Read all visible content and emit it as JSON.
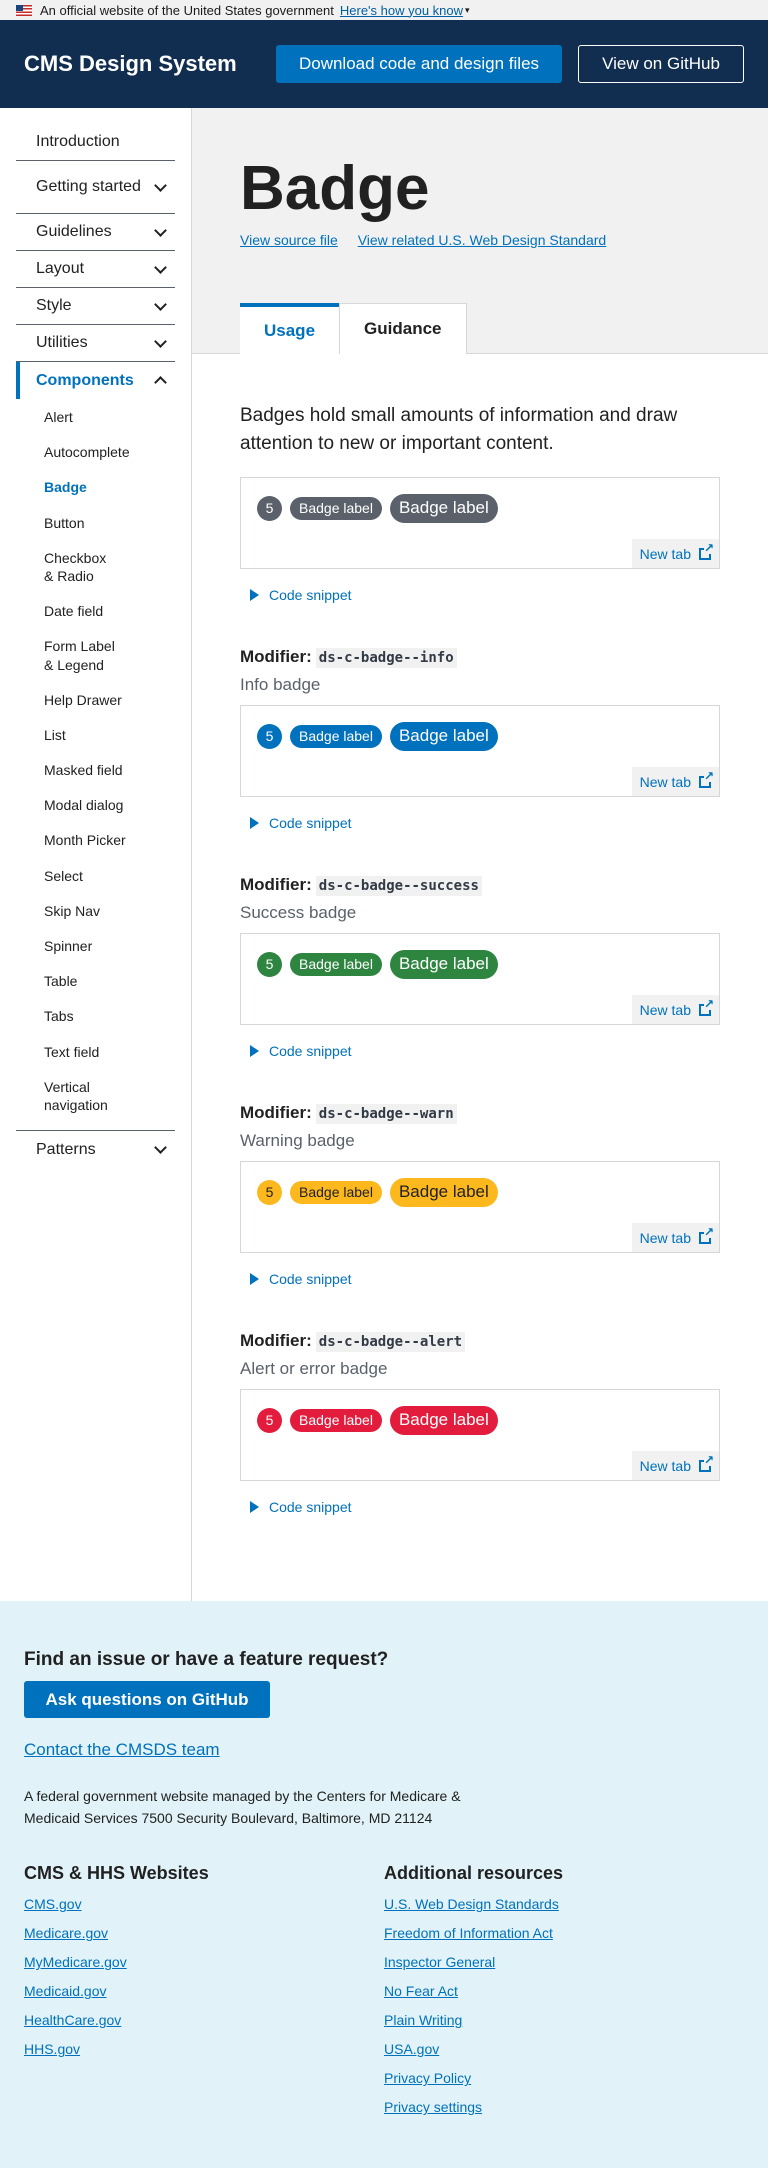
{
  "gov_banner": {
    "text": "An official website of the United States government",
    "link": "Here's how you know"
  },
  "header": {
    "logo": "CMS Design System",
    "download_label": "Download code and design files",
    "github_label": "View on GitHub"
  },
  "sidebar": {
    "top_items": [
      {
        "label": "Introduction"
      },
      {
        "label": "Getting started"
      },
      {
        "label": "Guidelines"
      },
      {
        "label": "Layout"
      },
      {
        "label": "Style"
      },
      {
        "label": "Utilities"
      }
    ],
    "components_label": "Components",
    "components": [
      "Alert",
      "Autocomplete",
      "Badge",
      "Button",
      "Checkbox & Radio",
      "Date field",
      "Form Label & Legend",
      "Help Drawer",
      "List",
      "Masked field",
      "Modal dialog",
      "Month Picker",
      "Select",
      "Skip Nav",
      "Spinner",
      "Table",
      "Tabs",
      "Text field",
      "Vertical navigation"
    ],
    "patterns_label": "Patterns"
  },
  "page": {
    "title": "Badge",
    "view_source": "View source file",
    "view_related": "View related U.S. Web Design Standard",
    "tab_usage": "Usage",
    "tab_guidance": "Guidance",
    "lead": "Badges hold small amounts of information and draw attention to new or important content."
  },
  "examples": {
    "badge_number": "5",
    "badge_label": "Badge label",
    "new_tab": "New tab",
    "code_snippet": "Code snippet",
    "modifier_prefix": "Modifier:",
    "default_color": "#5b616b",
    "variants": [
      {
        "code": "ds-c-badge--info",
        "desc": "Info badge",
        "color": "#0071bc",
        "text_color": "#ffffff"
      },
      {
        "code": "ds-c-badge--success",
        "desc": "Success badge",
        "color": "#2e8540",
        "text_color": "#ffffff"
      },
      {
        "code": "ds-c-badge--warn",
        "desc": "Warning badge",
        "color": "#fdb81e",
        "text_color": "#212121"
      },
      {
        "code": "ds-c-badge--alert",
        "desc": "Alert or error badge",
        "color": "#e31c3d",
        "text_color": "#ffffff"
      }
    ]
  },
  "footer": {
    "heading": "Find an issue or have a feature request?",
    "gh_button": "Ask questions on GitHub",
    "contact": "Contact the CMSDS team",
    "fed_text": "A federal government website managed by the Centers for Medicare & Medicaid Services 7500 Security Boulevard, Baltimore, MD 21124",
    "col1_title": "CMS & HHS Websites",
    "col1_links": [
      "CMS.gov",
      "Medicare.gov",
      "MyMedicare.gov",
      "Medicaid.gov",
      "HealthCare.gov",
      "HHS.gov"
    ],
    "col2_title": "Additional resources",
    "col2_links": [
      "U.S. Web Design Standards",
      "Freedom of Information Act",
      "Inspector General",
      "No Fear Act",
      "Plain Writing",
      "USA.gov",
      "Privacy Policy",
      "Privacy settings"
    ]
  }
}
